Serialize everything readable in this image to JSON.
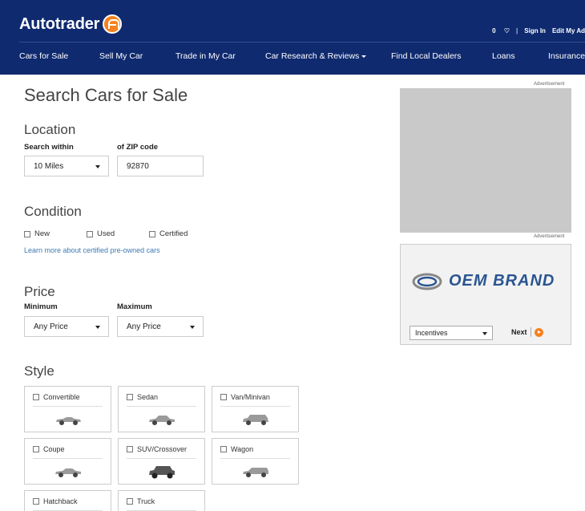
{
  "header": {
    "brand": "Autotrader",
    "favorites": "0",
    "sign_in": "Sign In",
    "edit_my_ad": "Edit My Ad",
    "nav": [
      "Cars for Sale",
      "Sell My Car",
      "Trade in My Car",
      "Car Research & Reviews",
      "Find Local Dealers",
      "Loans",
      "Insurance"
    ]
  },
  "main": {
    "title": "Search Cars for Sale",
    "location": {
      "title": "Location",
      "search_within_label": "Search within",
      "search_within_value": "10 Miles",
      "zip_label": "of ZIP code",
      "zip_value": "92870"
    },
    "condition": {
      "title": "Condition",
      "options": [
        "New",
        "Used",
        "Certified"
      ],
      "link": "Learn more about certified pre-owned cars"
    },
    "price": {
      "title": "Price",
      "min_label": "Minimum",
      "min_value": "Any Price",
      "max_label": "Maximum",
      "max_value": "Any Price"
    },
    "style": {
      "title": "Style",
      "options": [
        "Convertible",
        "Sedan",
        "Van/Minivan",
        "Coupe",
        "SUV/Crossover",
        "Wagon",
        "Hatchback",
        "Truck"
      ]
    }
  },
  "ads": {
    "label_1": "Advertisement",
    "label_2": "Advertisement",
    "oem_brand": "OEM BRAND",
    "select_value": "Incentives",
    "next_label": "Next"
  },
  "colors": {
    "header_bg": "#0f2a6f",
    "accent": "#f5821f",
    "link": "#3d7bb5"
  }
}
